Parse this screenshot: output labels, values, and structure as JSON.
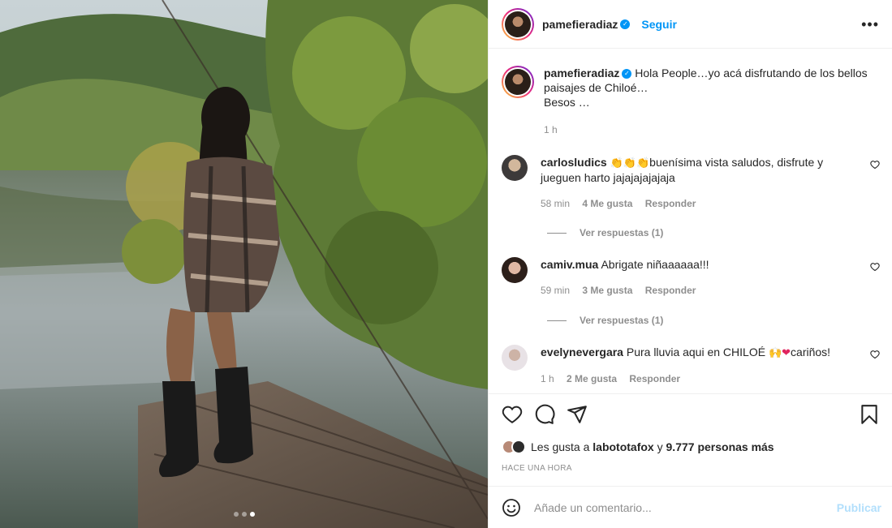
{
  "post": {
    "author": "pamefieradiaz",
    "follow_label": "Seguir",
    "more_label": "•••",
    "caption": "Hola People…yo acá disfrutando de los bellos paisajes de Chiloé…",
    "caption_line2": "Besos …",
    "caption_time": "1 h",
    "carousel": {
      "count": 3,
      "active_index": 2
    }
  },
  "comments": [
    {
      "user": "carlosludics",
      "emoji": "👏👏👏",
      "text": "buenísima vista saludos, disfrute y jueguen harto jajajajajajaja",
      "time": "58 min",
      "likes": "4 Me gusta",
      "reply": "Responder",
      "view_replies": "Ver respuestas (1)"
    },
    {
      "user": "camiv.mua",
      "text": "Abrigate niñaaaaaa!!!",
      "time": "59 min",
      "likes": "3 Me gusta",
      "reply": "Responder",
      "view_replies": "Ver respuestas (1)"
    },
    {
      "user": "evelynevergara",
      "text": "Pura lluvia aqui en CHILOÉ",
      "emoji_mid": "🙌",
      "emoji_heart": "❤",
      "text_end": "cariños!",
      "time": "1 h",
      "likes": "2 Me gusta",
      "reply": "Responder"
    }
  ],
  "likes_summary": {
    "prefix": "Les gusta a",
    "user": "labototafox",
    "middle": "y",
    "count": "9.777 personas más"
  },
  "timestamp": "HACE UNA HORA",
  "composer": {
    "placeholder": "Añade un comentario...",
    "publish_label": "Publicar"
  },
  "icons": [
    "heart-icon",
    "comment-icon",
    "share-icon",
    "bookmark-icon",
    "emoji-icon",
    "verified-icon",
    "more-icon"
  ],
  "colors": {
    "accent": "#0095f6",
    "publish_disabled": "#b2dffc",
    "muted": "#8e8e8e",
    "text": "#262626"
  }
}
